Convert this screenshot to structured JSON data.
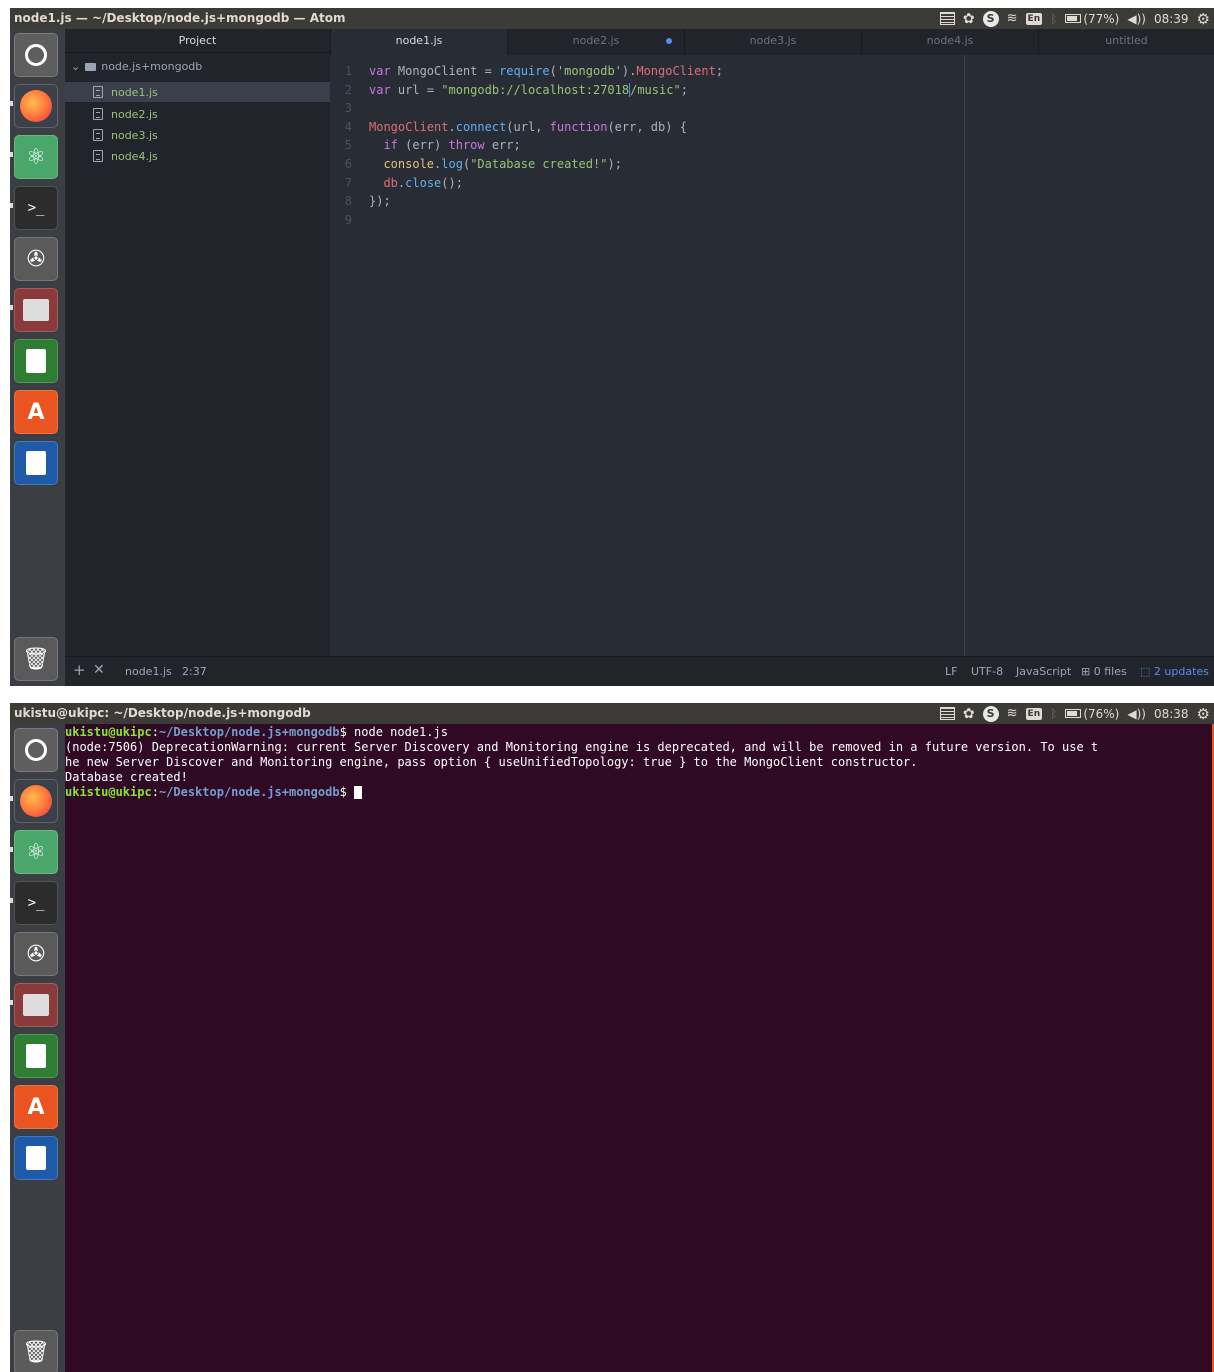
{
  "atom_window": {
    "title": "node1.js — ~/Desktop/node.js+mongodb — Atom",
    "tray": {
      "battery": "(77%)",
      "time": "08:39",
      "lang": "En",
      "skype": "S"
    },
    "tree": {
      "header": "Project",
      "folder": "node.js+mongodb",
      "files": [
        "node1.js",
        "node2.js",
        "node3.js",
        "node4.js"
      ]
    },
    "tabs": [
      "node1.js",
      "node2.js",
      "node3.js",
      "node4.js",
      "untitled"
    ],
    "code_lines": [
      {
        "n": "1",
        "tokens": [
          [
            "k",
            "var"
          ],
          [
            "v",
            " MongoClient "
          ],
          [
            "p",
            "= "
          ],
          [
            "f",
            "require"
          ],
          [
            "p",
            "("
          ],
          [
            "s",
            "'mongodb'"
          ],
          [
            "p",
            ")."
          ],
          [
            "r",
            "MongoClient"
          ],
          [
            "p",
            ";"
          ]
        ]
      },
      {
        "n": "2",
        "tokens": [
          [
            "k",
            "var"
          ],
          [
            "v",
            " url "
          ],
          [
            "p",
            "= "
          ],
          [
            "s",
            "\"mongodb://localhost:27018"
          ],
          [
            "caret",
            ""
          ],
          [
            "s",
            "/music\""
          ],
          [
            "p",
            ";"
          ]
        ]
      },
      {
        "n": "3",
        "tokens": []
      },
      {
        "n": "4",
        "tokens": [
          [
            "r",
            "MongoClient"
          ],
          [
            "p",
            "."
          ],
          [
            "f",
            "connect"
          ],
          [
            "p",
            "(url, "
          ],
          [
            "k",
            "function"
          ],
          [
            "p",
            "(err, db) {"
          ]
        ]
      },
      {
        "n": "5",
        "tokens": [
          [
            "p",
            "  "
          ],
          [
            "k",
            "if"
          ],
          [
            "p",
            " (err) "
          ],
          [
            "k",
            "throw"
          ],
          [
            "p",
            " err;"
          ]
        ]
      },
      {
        "n": "6",
        "tokens": [
          [
            "p",
            "  "
          ],
          [
            "c",
            "console"
          ],
          [
            "p",
            "."
          ],
          [
            "f",
            "log"
          ],
          [
            "p",
            "("
          ],
          [
            "s",
            "\"Database created!\""
          ],
          [
            "p",
            ");"
          ]
        ]
      },
      {
        "n": "7",
        "tokens": [
          [
            "p",
            "  "
          ],
          [
            "r",
            "db"
          ],
          [
            "p",
            "."
          ],
          [
            "f",
            "close"
          ],
          [
            "p",
            "();"
          ]
        ]
      },
      {
        "n": "8",
        "tokens": [
          [
            "p",
            "});"
          ]
        ]
      },
      {
        "n": "9",
        "tokens": []
      }
    ],
    "status": {
      "file": "node1.js",
      "cursor": "2:37",
      "line_ending": "LF",
      "encoding": "UTF-8",
      "grammar": "JavaScript",
      "git_files": "0 files",
      "updates": "2 updates"
    }
  },
  "terminal_window": {
    "title": "ukistu@ukipc: ~/Desktop/node.js+mongodb",
    "tray": {
      "battery": "(76%)",
      "time": "08:38",
      "lang": "En",
      "skype": "S"
    },
    "prompt_user": "ukistu@ukipc",
    "prompt_path": "~/Desktop/node.js+mongodb",
    "command": " node node1.js",
    "output": [
      "(node:7506) DeprecationWarning: current Server Discovery and Monitoring engine is deprecated, and will be removed in a future version. To use t",
      "he new Server Discover and Monitoring engine, pass option { useUnifiedTopology: true } to the MongoClient constructor.",
      "Database created!"
    ]
  },
  "launcher_icons": [
    "ubuntu-dash-icon",
    "firefox-icon",
    "atom-icon",
    "terminal-icon",
    "system-settings-icon",
    "file-manager-icon",
    "libreoffice-calc-icon",
    "software-center-icon",
    "libreoffice-impress-icon",
    "trash-icon"
  ]
}
